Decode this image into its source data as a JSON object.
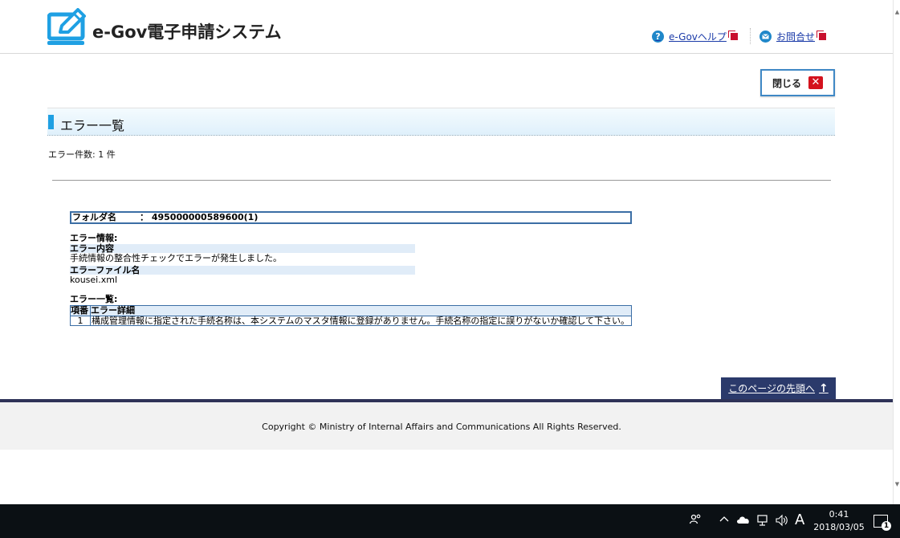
{
  "header": {
    "app_title": "e-Gov電子申請システム",
    "help_link": "e-Govヘルプ",
    "contact_link": "お問合せ"
  },
  "close_button": {
    "label": "閉じる",
    "icon": "close-x-icon"
  },
  "page_title": "エラー一覧",
  "error_count": "エラー件数: 1 件",
  "folder": {
    "label": "フォルダ名",
    "value": "： 495000000589600(1)"
  },
  "error_info": {
    "heading": "エラー情報:",
    "content_label": "エラー内容",
    "content_text": "手続情報の整合性チェックでエラーが発生しました。",
    "file_label": "エラーファイル名",
    "file_text": "kousei.xml"
  },
  "error_list": {
    "heading": "エラー一覧:",
    "columns": [
      "項番",
      "エラー詳細"
    ],
    "rows": [
      {
        "no": "1",
        "detail": "構成管理情報に指定された手続名称は、本システムのマスタ情報に登録がありません。手続名称の指定に誤りがないか確認して下さい。"
      }
    ]
  },
  "page_top_link": "このページの先頭へ",
  "copyright": "Copyright © Ministry of Internal Affairs and Communications All Rights Reserved.",
  "taskbar": {
    "ime": "A",
    "time": "0:41",
    "date": "2018/03/05",
    "notification_count": "1"
  },
  "colors": {
    "accent": "#1fa0e3",
    "navy": "#2b3a6b",
    "close_red": "#d4121d",
    "link": "#1a3aa8"
  }
}
